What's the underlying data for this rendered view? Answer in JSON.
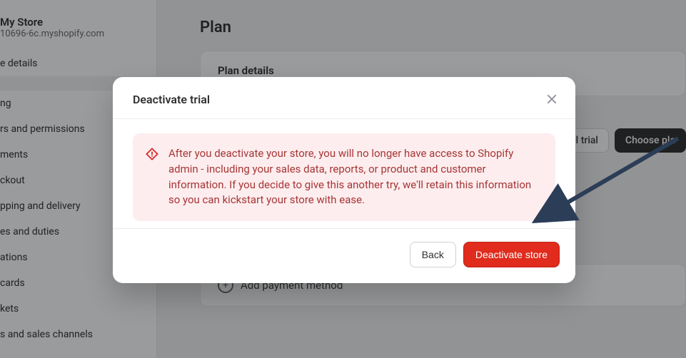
{
  "store": {
    "name": "My Store",
    "domain": "10696-6c.myshopify.com"
  },
  "sidebar": {
    "items": [
      {
        "label": "e details"
      },
      {
        "label": ""
      },
      {
        "label": "ng"
      },
      {
        "label": "rs and permissions"
      },
      {
        "label": "ments"
      },
      {
        "label": "ckout"
      },
      {
        "label": "pping and delivery"
      },
      {
        "label": "es and duties"
      },
      {
        "label": "ations"
      },
      {
        "label": "cards"
      },
      {
        "label": "kets"
      },
      {
        "label": "s and sales channels"
      }
    ]
  },
  "main": {
    "title": "Plan",
    "plan_details": "Plan details",
    "cancel_trial": "Cancel trial",
    "choose_plan": "Choose pla",
    "add_payment": "Add payment method"
  },
  "modal": {
    "title": "Deactivate trial",
    "alert": "After you deactivate your store, you will no longer have access to Shopify admin - including your sales data, reports, or product and customer information. If you decide to give this another try, we'll retain this information so you can kickstart your store with ease.",
    "back": "Back",
    "deactivate": "Deactivate store"
  }
}
